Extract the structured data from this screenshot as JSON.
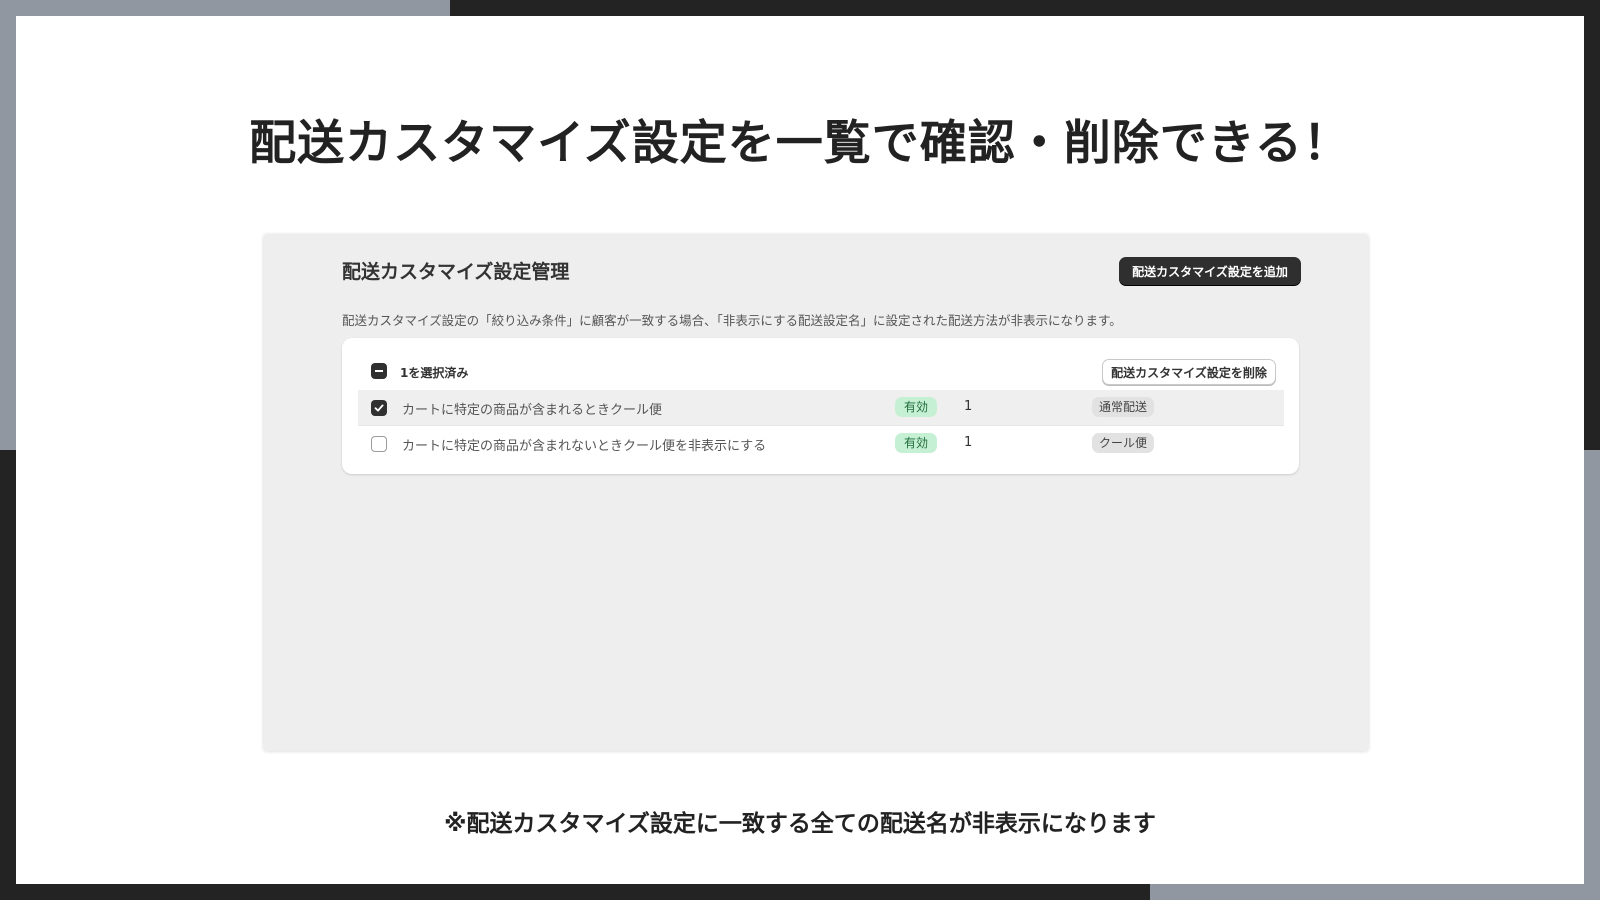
{
  "slide": {
    "headline": "配送カスタマイズ設定を一覧で確認・削除できる！",
    "footnote": "※配送カスタマイズ設定に一致する全ての配送名が非表示になります"
  },
  "app": {
    "page_title": "配送カスタマイズ設定管理",
    "add_button": "配送カスタマイズ設定を追加",
    "description": "配送カスタマイズ設定の「絞り込み条件」に顧客が一致する場合、「非表示にする配送設定名」に設定された配送方法が非表示になります。",
    "bulk": {
      "selected_label": "1を選択済み",
      "delete_button": "配送カスタマイズ設定を削除"
    },
    "rows": [
      {
        "checked": true,
        "name": "カートに特定の商品が含まれるときクール便",
        "status": "有効",
        "count": "1",
        "tag": "通常配送"
      },
      {
        "checked": false,
        "name": "カートに特定の商品が含まれないときクール便を非表示にする",
        "status": "有効",
        "count": "1",
        "tag": "クール便"
      }
    ]
  },
  "colors": {
    "frame_dark": "#232323",
    "frame_gray": "#9097a0",
    "primary_button": "#2f2f2f",
    "status_badge_bg": "#c6f0d4",
    "status_badge_text": "#1f6b3a"
  },
  "icons": [
    "indeterminate-checkbox-icon",
    "checked-checkbox-icon",
    "unchecked-checkbox-icon"
  ]
}
